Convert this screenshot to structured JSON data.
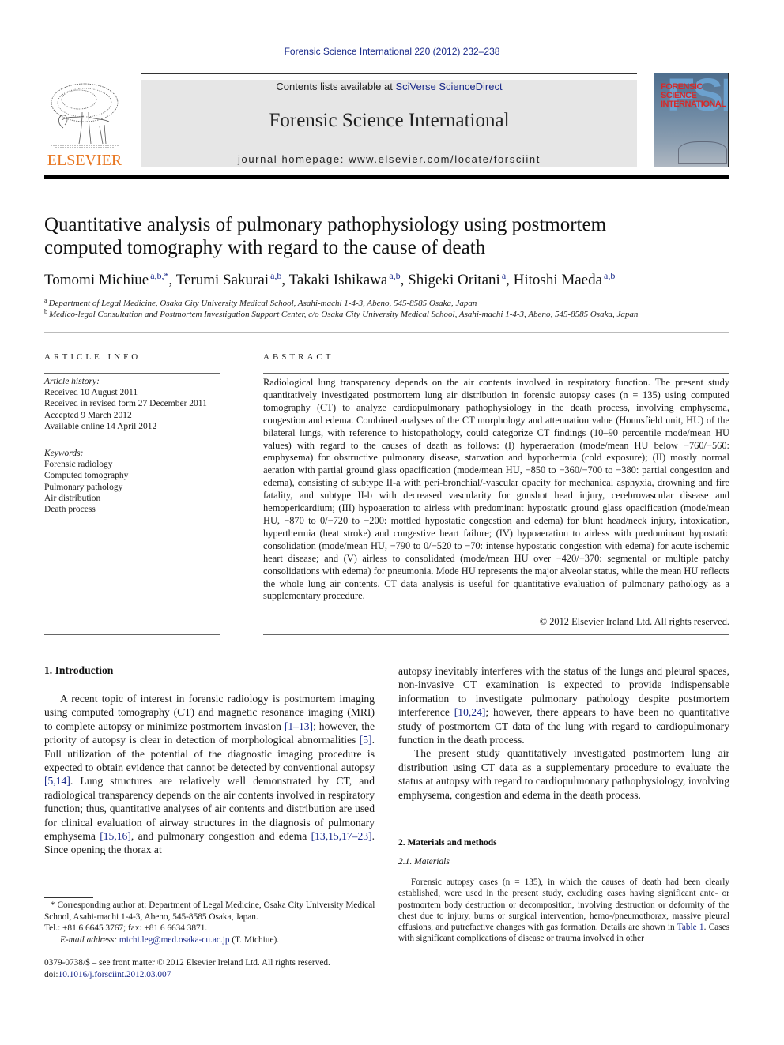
{
  "header": {
    "journal_ref": "Forensic Science International 220 (2012) 232–238",
    "contents_prefix": "Contents lists available at ",
    "contents_link": "SciVerse ScienceDirect",
    "journal_title": "Forensic Science International",
    "homepage": "journal homepage: www.elsevier.com/locate/forsciint",
    "publisher_logo": "ELSEVIER",
    "cover": {
      "big_letters": "FSI",
      "title_lines": [
        "FORENSIC",
        "SCIENCE",
        "INTERNATIONAL"
      ]
    },
    "colors": {
      "link": "#1a2a8a",
      "elsevier_orange": "#e87722",
      "banner_bg": "#e6e6e6"
    }
  },
  "article": {
    "title_line1": "Quantitative analysis of pulmonary pathophysiology using postmortem",
    "title_line2": "computed tomography with regard to the cause of death",
    "authors": [
      {
        "name": "Tomomi Michiue",
        "sup": "a,b,*",
        "sep": ", "
      },
      {
        "name": "Terumi Sakurai",
        "sup": "a,b",
        "sep": ", "
      },
      {
        "name": "Takaki Ishikawa",
        "sup": "a,b",
        "sep": ", "
      },
      {
        "name": "Shigeki Oritani",
        "sup": "a",
        "sep": ", "
      },
      {
        "name": "Hitoshi Maeda",
        "sup": "a,b",
        "sep": ""
      }
    ],
    "affiliations": [
      {
        "mark": "a",
        "text": "Department of Legal Medicine, Osaka City University Medical School, Asahi-machi 1-4-3, Abeno, 545-8585 Osaka, Japan"
      },
      {
        "mark": "b",
        "text": "Medico-legal Consultation and Postmortem Investigation Support Center, c/o Osaka City University Medical School, Asahi-machi 1-4-3, Abeno, 545-8585 Osaka, Japan"
      }
    ]
  },
  "article_info": {
    "label": "ARTICLE INFO",
    "history_heading": "Article history:",
    "history": [
      "Received 10 August 2011",
      "Received in revised form 27 December 2011",
      "Accepted 9 March 2012",
      "Available online 14 April 2012"
    ],
    "keywords_heading": "Keywords:",
    "keywords": [
      "Forensic radiology",
      "Computed tomography",
      "Pulmonary pathology",
      "Air distribution",
      "Death process"
    ]
  },
  "abstract": {
    "label": "ABSTRACT",
    "text": "Radiological lung transparency depends on the air contents involved in respiratory function. The present study quantitatively investigated postmortem lung air distribution in forensic autopsy cases (n = 135) using computed tomography (CT) to analyze cardiopulmonary pathophysiology in the death process, involving emphysema, congestion and edema. Combined analyses of the CT morphology and attenuation value (Hounsfield unit, HU) of the bilateral lungs, with reference to histopathology, could categorize CT findings (10–90 percentile mode/mean HU values) with regard to the causes of death as follows: (I) hyperaeration (mode/mean HU below −760/−560: emphysema) for obstructive pulmonary disease, starvation and hypothermia (cold exposure); (II) mostly normal aeration with partial ground glass opacification (mode/mean HU, −850 to −360/−700 to −380: partial congestion and edema), consisting of subtype II-a with peri-bronchial/-vascular opacity for mechanical asphyxia, drowning and fire fatality, and subtype II-b with decreased vascularity for gunshot head injury, cerebrovascular disease and hemopericardium; (III) hypoaeration to airless with predominant hypostatic ground glass opacification (mode/mean HU, −870 to 0/−720 to −200: mottled hypostatic congestion and edema) for blunt head/neck injury, intoxication, hyperthermia (heat stroke) and congestive heart failure; (IV) hypoaeration to airless with predominant hypostatic consolidation (mode/mean HU, −790 to 0/−520 to −70: intense hypostatic congestion with edema) for acute ischemic heart disease; and (V) airless to consolidated (mode/mean HU over −420/−370: segmental or multiple patchy consolidations with edema) for pneumonia. Mode HU represents the major alveolar status, while the mean HU reflects the whole lung air contents. CT data analysis is useful for quantitative evaluation of pulmonary pathology as a supplementary procedure.",
    "copyright": "© 2012 Elsevier Ireland Ltd. All rights reserved."
  },
  "intro": {
    "heading": "1.  Introduction",
    "p1_a": "A recent topic of interest in forensic radiology is postmortem imaging using computed tomography (CT) and magnetic resonance imaging (MRI) to complete autopsy or minimize postmortem invasion ",
    "ref1": "[1–13]",
    "p1_b": "; however, the priority of autopsy is clear in detection of morphological abnormalities ",
    "ref2": "[5]",
    "p1_c": ". Full utilization of the potential of the diagnostic imaging procedure is expected to obtain evidence that cannot be detected by conventional autopsy ",
    "ref3": "[5,14]",
    "p1_d": ". Lung structures are relatively well demonstrated by CT, and radiological transparency depends on the air contents involved in respiratory function; thus, quantitative analyses of air contents and distribution are used for clinical evaluation of airway structures in the diagnosis of pulmonary emphysema ",
    "ref4": "[15,16]",
    "p1_e": ", and pulmonary congestion and edema ",
    "ref5": "[13,15,17–23]",
    "p1_f": ". Since opening the thorax at",
    "p1_cont_a": "autopsy inevitably interferes with the status of the lungs and pleural spaces, non-invasive CT examination is expected to provide indispensable information to investigate pulmonary pathology despite postmortem interference ",
    "ref6": "[10,24]",
    "p1_cont_b": "; however, there appears to have been no quantitative study of postmortem CT data of the lung with regard to cardiopulmonary function in the death process.",
    "p2": "The present study quantitatively investigated postmortem lung air distribution using CT data as a supplementary procedure to evaluate the status at autopsy with regard to cardiopulmonary pathophysiology, involving emphysema, congestion and edema in the death process."
  },
  "methods": {
    "heading": "2.  Materials and methods",
    "sub_heading": "2.1.  Materials",
    "p1_a": "Forensic autopsy cases (n = 135), in which the causes of death had been clearly established, were used in the present study, excluding cases having significant ante- or postmortem body destruction or decomposition, involving destruction or deformity of the chest due to injury, burns or surgical intervention, hemo-/pneumothorax, massive pleural effusions, and putrefactive changes with gas formation. Details are shown in ",
    "table_ref": "Table 1",
    "p1_b": ". Cases with significant complications of disease or trauma involved in other"
  },
  "footnotes": {
    "corresponding": "* Corresponding author at: Department of Legal Medicine, Osaka City University Medical School, Asahi-machi 1-4-3, Abeno, 545-8585 Osaka, Japan.",
    "tel": "Tel.: +81 6 6645 3767; fax: +81 6 6634 3871.",
    "email_label": "E-mail address: ",
    "email": "michi.leg@med.osaka-cu.ac.jp",
    "email_suffix": " (T. Michiue).",
    "issn": "0379-0738/$ – see front matter © 2012 Elsevier Ireland Ltd. All rights reserved.",
    "doi_prefix": "doi:",
    "doi": "10.1016/j.forsciint.2012.03.007"
  }
}
